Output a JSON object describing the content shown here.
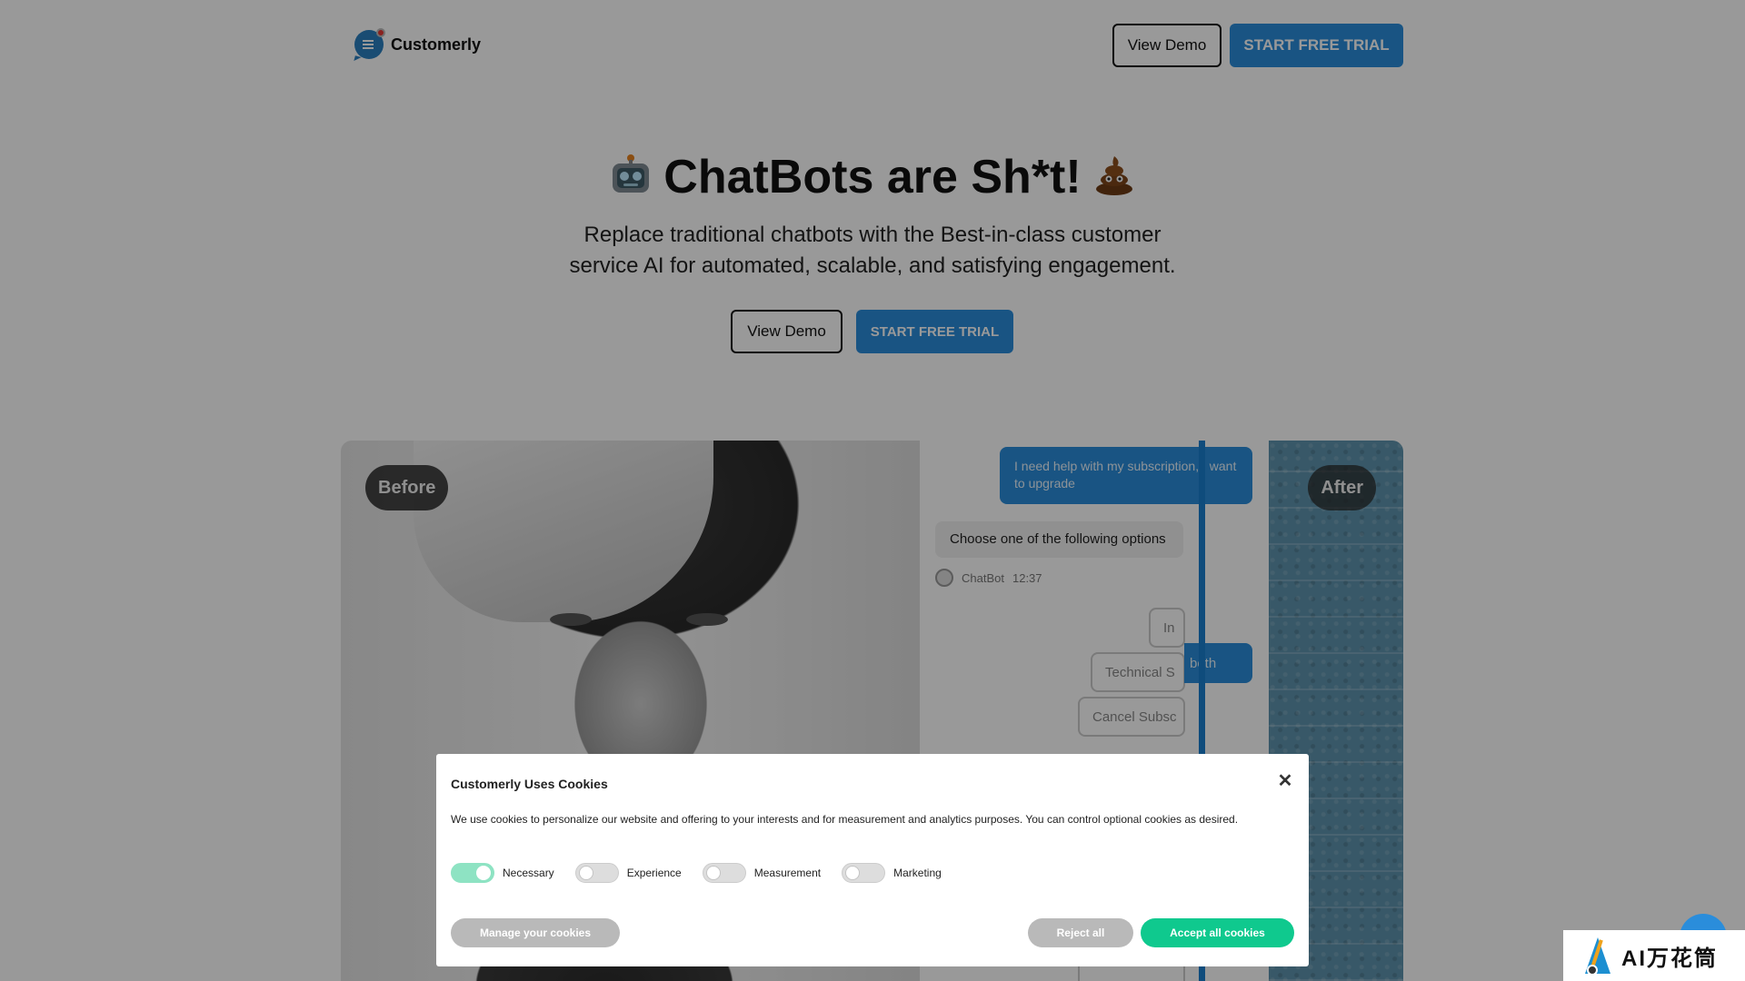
{
  "header": {
    "brand": "Customerly",
    "view_demo_label": "View Demo",
    "trial_label": "START FREE TRIAL"
  },
  "hero": {
    "title": "ChatBots are Sh*t!",
    "title_emoji_left": "robot-emoji",
    "title_emoji_right": "poop-emoji",
    "subtitle": "Replace traditional chatbots with the Best-in-class customer service AI for automated, scalable, and satisfying engagement.",
    "view_demo_label": "View Demo",
    "trial_label": "START FREE TRIAL"
  },
  "comparison": {
    "before_label": "Before",
    "after_label": "After",
    "user_message": "I need help with my subscription, I want to upgrade",
    "bot_message": "Choose one of the following options",
    "bot_name": "ChatBot",
    "bot_time": "12:37",
    "options": [
      "In",
      "Technical S",
      "Cancel Subsc"
    ],
    "reply_fragment": "both"
  },
  "cookie_modal": {
    "title": "Customerly Uses Cookies",
    "description": "We use cookies to personalize our website and offering to your interests and for measurement and analytics purposes. You can control optional cookies as desired.",
    "toggles": [
      {
        "label": "Necessary",
        "on": true
      },
      {
        "label": "Experience",
        "on": false
      },
      {
        "label": "Measurement",
        "on": false
      },
      {
        "label": "Marketing",
        "on": false
      }
    ],
    "manage_label": "Manage your cookies",
    "reject_label": "Reject all",
    "accept_label": "Accept all cookies",
    "close_glyph": "✕"
  },
  "watermark": {
    "text": "AI万花筒"
  },
  "colors": {
    "primary": "#2a8ddb",
    "accept": "#0fc98e",
    "toggle_on": "#8ee3c3",
    "neutral_button": "#b9b9b9"
  }
}
